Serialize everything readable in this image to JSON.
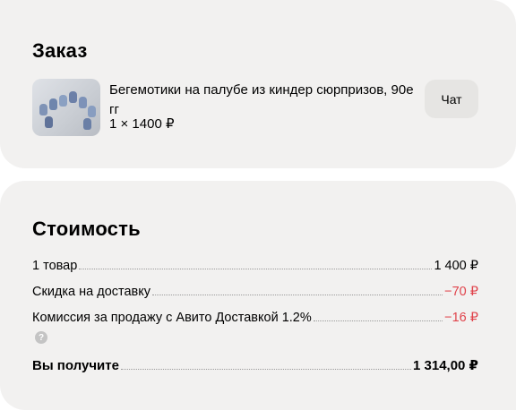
{
  "order": {
    "title": "Заказ",
    "item": {
      "thumbnail_icon": "kinder-hippo-figures-photo",
      "title": "Бегемотики на палубе из киндер сюрпризов, 90е гг",
      "quantity_price": "1 × 1400 ₽"
    },
    "chat_label": "Чат"
  },
  "cost": {
    "title": "Стоимость",
    "rows": [
      {
        "label": "1 товар",
        "value": "1 400 ₽"
      },
      {
        "label": "Скидка на доставку",
        "value": "−70 ₽"
      },
      {
        "label": "Комиссия за продажу с Авито Доставкой 1.2%",
        "value": "−16 ₽"
      }
    ],
    "help_icon_glyph": "?",
    "total": {
      "label": "Вы получите",
      "value": "1 314,00 ₽"
    }
  },
  "colors": {
    "card_bg": "#f2f1f0",
    "negative": "#e0434b",
    "button_bg": "#e6e5e3"
  }
}
